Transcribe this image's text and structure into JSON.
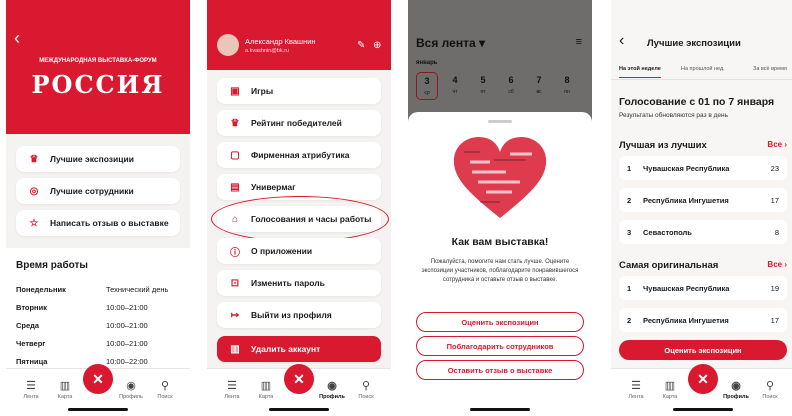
{
  "screen1": {
    "back_glyph": "‹",
    "exhibition_subtitle": "МЕЖДУНАРОДНАЯ ВЫСТАВКА-ФОРУМ",
    "exhibition_logo": "РОССИЯ",
    "menu": [
      {
        "icon": "trophy-icon",
        "label": "Лучшие экспозиции"
      },
      {
        "icon": "medal-icon",
        "label": "Лучшие сотрудники"
      },
      {
        "icon": "star-icon",
        "label": "Написать отзыв о выставке"
      }
    ],
    "hours_title": "Время работы",
    "hours": [
      {
        "day": "Понедельник",
        "time": "Технический день"
      },
      {
        "day": "Вторник",
        "time": "10:00–21:00"
      },
      {
        "day": "Среда",
        "time": "10:00–21:00"
      },
      {
        "day": "Четверг",
        "time": "10:00–21:00"
      },
      {
        "day": "Пятница",
        "time": "10:00–22:00"
      }
    ]
  },
  "screen2": {
    "user_name": "Александр Квашнин",
    "user_email": "a.kvashnin@bk.ru",
    "menu": [
      {
        "icon": "gamepad-icon",
        "label": "Игры"
      },
      {
        "icon": "trophy-icon",
        "label": "Рейтинг победителей"
      },
      {
        "icon": "shopping-bag-icon",
        "label": "Фирменная атрибутика"
      },
      {
        "icon": "store-icon",
        "label": "Универмаг"
      },
      {
        "icon": "building-icon",
        "label": "Голосования и часы работы"
      },
      {
        "icon": "info-icon",
        "label": "О приложении"
      },
      {
        "icon": "lock-icon",
        "label": "Изменить пароль"
      },
      {
        "icon": "logout-icon",
        "label": "Выйти из профиля"
      }
    ],
    "delete_label": "Удалить аккаунт"
  },
  "screen3": {
    "feed_title": "Вся лента",
    "month": "январь",
    "days": [
      {
        "num": "3",
        "dow": "ср"
      },
      {
        "num": "4",
        "dow": "чт"
      },
      {
        "num": "5",
        "dow": "пт"
      },
      {
        "num": "6",
        "dow": "сб"
      },
      {
        "num": "7",
        "dow": "вс"
      },
      {
        "num": "8",
        "dow": "пн"
      }
    ],
    "question": "Как вам выставка!",
    "description": "Пожалуйста, помогите нам стать лучше. Оцените экспозиции участников, поблагодарите понравившегося сотрудника и оставьте отзыв о выставке.",
    "buttons": [
      "Оценить экспозицин",
      "Поблагодарить сотрудников",
      "Оставить отзыв о выставке"
    ]
  },
  "screen4": {
    "title": "Лучшие экспозиции",
    "tabs": [
      "На этой неделе",
      "На прошлой нед.",
      "За всё время"
    ],
    "voting_title": "Голосование с 01 по 7 января",
    "voting_note": "Результаты обновляются раз в день",
    "best_title": "Лучшая из лучших",
    "all_label": "Все",
    "best": [
      {
        "rank": "1",
        "name": "Чувашская Республика",
        "count": "23"
      },
      {
        "rank": "2",
        "name": "Республика Ингушетия",
        "count": "17"
      },
      {
        "rank": "3",
        "name": "Севастополь",
        "count": "8"
      }
    ],
    "original_title": "Самая оригинальная",
    "original": [
      {
        "rank": "1",
        "name": "Чувашская Республика",
        "count": "19"
      },
      {
        "rank": "2",
        "name": "Республика Ингушетия",
        "count": "17"
      }
    ],
    "cta": "Оценить экспозицин"
  },
  "tabbar": {
    "items": [
      "Лента",
      "Карта",
      "Профиль",
      "Поиск"
    ]
  },
  "colors": {
    "accent": "#d8192f",
    "background": "#f5f3f1"
  }
}
